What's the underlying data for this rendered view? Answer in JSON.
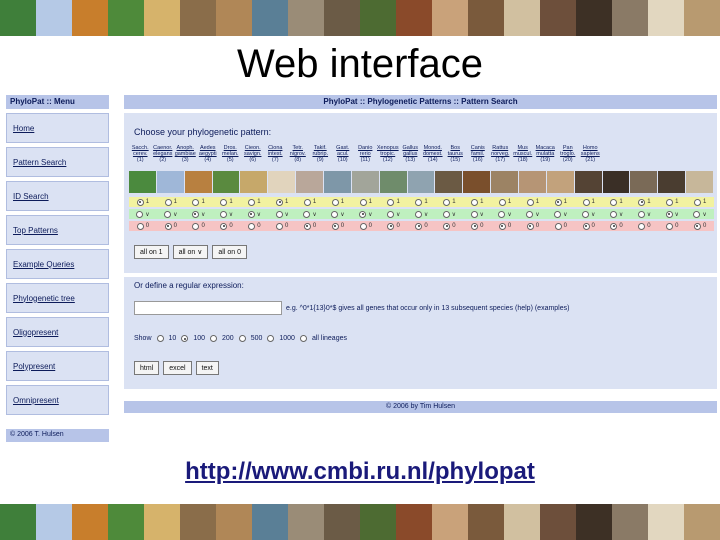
{
  "slide": {
    "title": "Web interface",
    "url": "http://www.cmbi.ru.nl/phylopat"
  },
  "strip_colors": [
    "#3f7f3a",
    "#b5c9e6",
    "#c87e2c",
    "#4e8a3a",
    "#d6b36b",
    "#8a6d4a",
    "#b08757",
    "#5a7f96",
    "#9a8c77",
    "#6b5b46",
    "#4d6b32",
    "#8a4a2a",
    "#c9a27a",
    "#7a5a3c",
    "#d1c0a0",
    "#6d4f3b",
    "#3d3025",
    "#8a7a66",
    "#e2d7c0",
    "#b89a70"
  ],
  "menu": {
    "header": "PhyloPat :: Menu",
    "items": [
      {
        "label": "Home"
      },
      {
        "label": "Pattern Search"
      },
      {
        "label": "ID Search"
      },
      {
        "label": "Top Patterns"
      },
      {
        "label": "Example Queries"
      },
      {
        "label": "Phylogenetic tree"
      },
      {
        "label": "Oligopresent"
      },
      {
        "label": "Polypresent"
      },
      {
        "label": "Omnipresent"
      }
    ],
    "footer": "© 2006 T. Hulsen"
  },
  "main": {
    "header": "PhyloPat :: Phylogenetic Patterns :: Pattern Search",
    "choose_label": "Choose your phylogenetic pattern:",
    "species": [
      {
        "name": "Sacch. cerev.",
        "num": "(1)"
      },
      {
        "name": "Caenor. elegans",
        "num": "(2)"
      },
      {
        "name": "Anoph. gambiae",
        "num": "(3)"
      },
      {
        "name": "Aedes aegypti",
        "num": "(4)"
      },
      {
        "name": "Dros. melan.",
        "num": "(5)"
      },
      {
        "name": "Cieon. savign.",
        "num": "(6)"
      },
      {
        "name": "Ciona intest.",
        "num": "(7)"
      },
      {
        "name": "Tetr. nigrov.",
        "num": "(8)"
      },
      {
        "name": "Takif. rubrip.",
        "num": "(9)"
      },
      {
        "name": "Gast. acul.",
        "num": "(10)"
      },
      {
        "name": "Danio rerio",
        "num": "(11)"
      },
      {
        "name": "Xenopus tropic.",
        "num": "(12)"
      },
      {
        "name": "Gallus gallus",
        "num": "(13)"
      },
      {
        "name": "Monod. domest.",
        "num": "(14)"
      },
      {
        "name": "Bos taurus",
        "num": "(15)"
      },
      {
        "name": "Canis famil.",
        "num": "(16)"
      },
      {
        "name": "Rattus norveg.",
        "num": "(17)"
      },
      {
        "name": "Mus muscul.",
        "num": "(18)"
      },
      {
        "name": "Macaca mulatta",
        "num": "(19)"
      },
      {
        "name": "Pan troglo.",
        "num": "(20)"
      },
      {
        "name": "Homo sapiens",
        "num": "(21)"
      }
    ],
    "species_colors": [
      "#4b8a3e",
      "#9fb7d8",
      "#b88040",
      "#5a8a3f",
      "#c6a86a",
      "#e1d4bd",
      "#b9a79a",
      "#7e97a8",
      "#a2a59a",
      "#6f8c6b",
      "#8fa3b0",
      "#6b5a44",
      "#7a4f2c",
      "#9c8364",
      "#b69575",
      "#c2a27c",
      "#544334",
      "#3a2f26",
      "#7a6a57",
      "#4a3d30",
      "#c7b79a"
    ],
    "row1_selected": [
      1,
      0,
      0,
      0,
      0,
      1,
      0,
      0,
      0,
      0,
      0,
      0,
      0,
      0,
      0,
      1,
      0,
      0,
      1,
      0,
      0
    ],
    "row2_selected": [
      0,
      0,
      1,
      0,
      1,
      0,
      0,
      0,
      1,
      0,
      0,
      0,
      0,
      0,
      0,
      0,
      0,
      0,
      0,
      1,
      0
    ],
    "row3_selected": [
      0,
      1,
      0,
      1,
      0,
      0,
      1,
      1,
      0,
      1,
      1,
      1,
      1,
      1,
      1,
      0,
      1,
      1,
      0,
      0,
      1
    ],
    "row1_mark": "1",
    "row2_mark": "∨",
    "row3_mark": "0",
    "all_buttons": [
      "all on 1",
      "all on ∨",
      "all on 0"
    ],
    "regex_label": "Or define a regular expression:",
    "regex_hint": "e.g. ^0*1{13}0*$ gives all genes that occur only in 13 subsequent species (help) (examples)",
    "show_label": "Show",
    "show_options": [
      {
        "label": "10",
        "selected": false
      },
      {
        "label": "100",
        "selected": true
      },
      {
        "label": "200",
        "selected": false
      },
      {
        "label": "500",
        "selected": false
      },
      {
        "label": "1000",
        "selected": false
      },
      {
        "label": "all lineages",
        "selected": false
      }
    ],
    "output_buttons": [
      "html",
      "excel",
      "text"
    ],
    "footer": "© 2006 by Tim Hulsen"
  }
}
